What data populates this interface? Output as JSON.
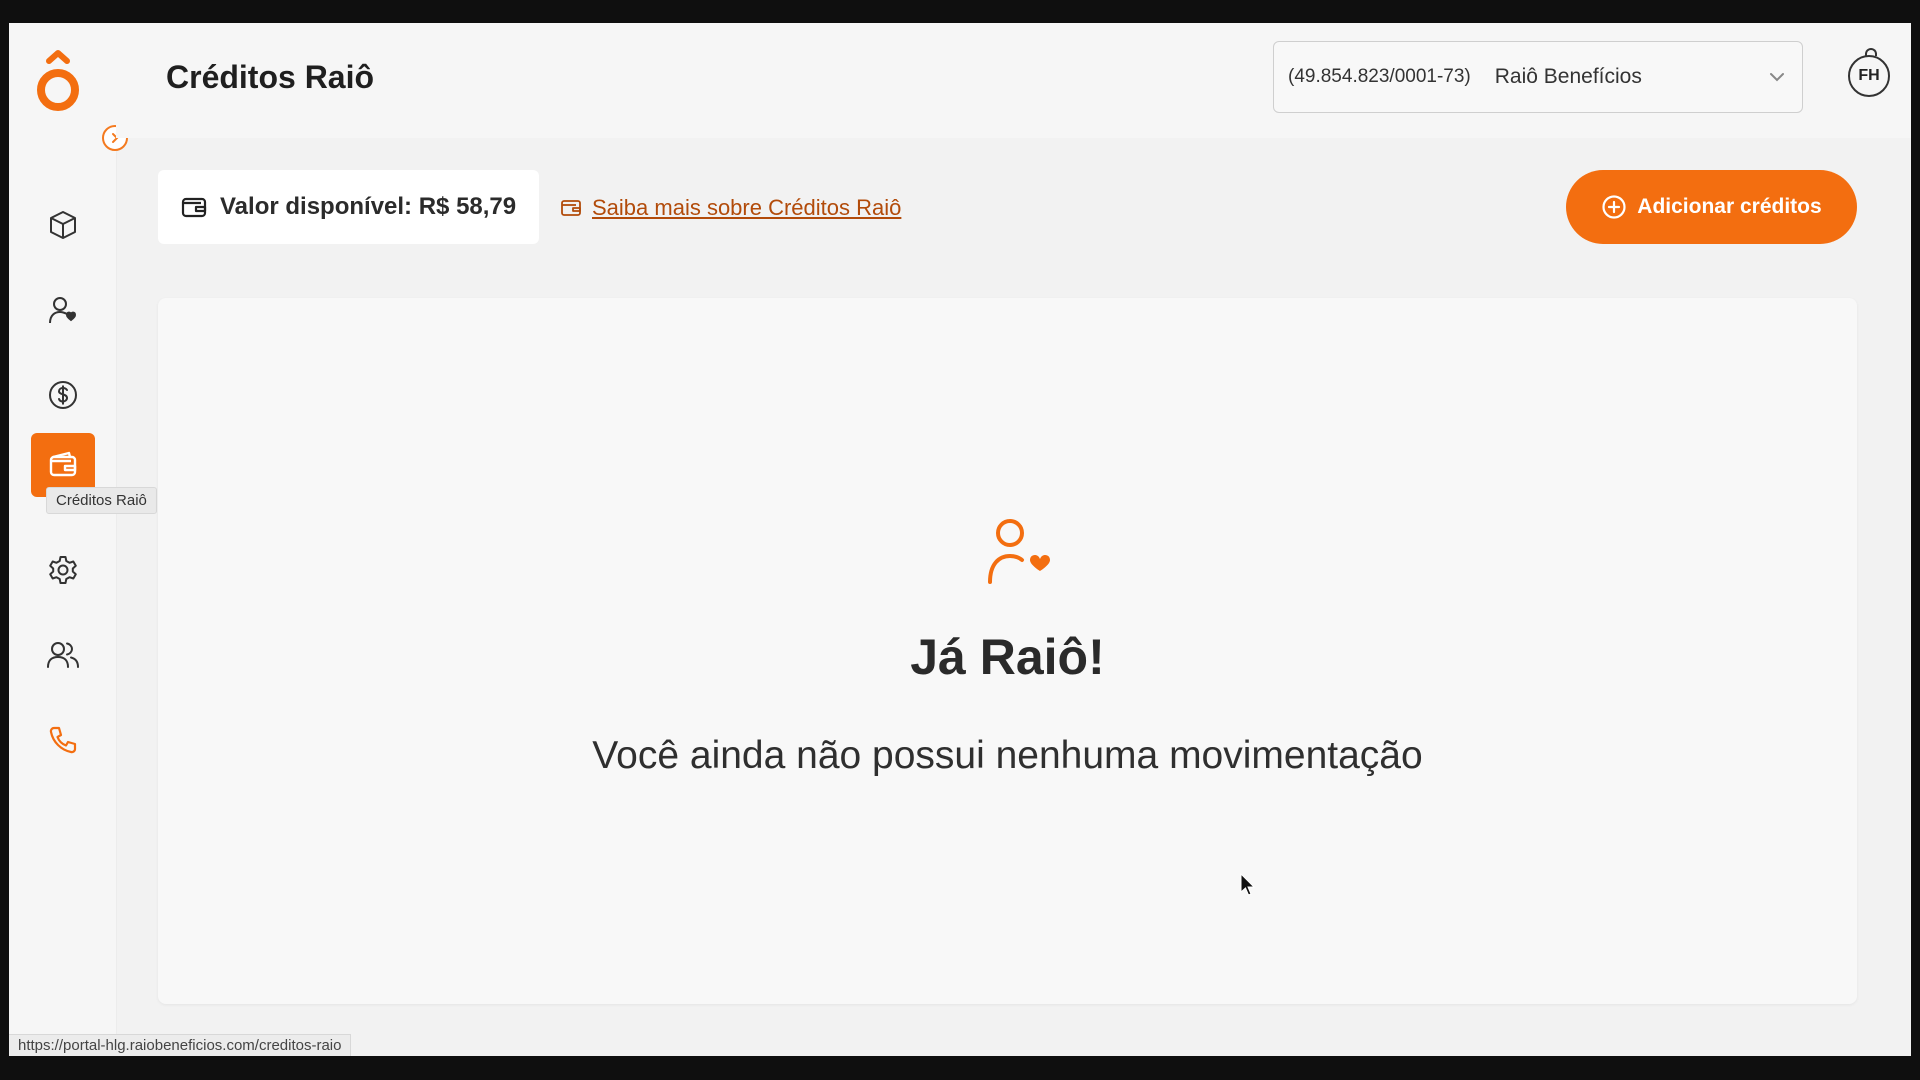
{
  "app": {
    "title": "Créditos Raiô"
  },
  "header": {
    "company_doc": "(49.854.823/0001-73)",
    "company_name": "Raiô Benefícios",
    "avatar_initials": "FH"
  },
  "sidebar": {
    "items": [
      {
        "icon": "box-icon",
        "label": ""
      },
      {
        "icon": "user-heart-icon",
        "label": ""
      },
      {
        "icon": "dollar-circle-icon",
        "label": ""
      },
      {
        "icon": "wallet-icon",
        "label": "Créditos Raiô",
        "active": true
      },
      {
        "icon": "gear-icon",
        "label": ""
      },
      {
        "icon": "users-icon",
        "label": ""
      },
      {
        "icon": "phone-icon",
        "label": ""
      }
    ],
    "tooltip": "Créditos Raiô"
  },
  "balance": {
    "label": "Valor disponível: R$ 58,79",
    "learn_more": "Saiba mais sobre Créditos Raiô"
  },
  "actions": {
    "add_credits": "Adicionar créditos"
  },
  "empty_state": {
    "title": "Já Raiô!",
    "subtitle": "Você ainda não possui nenhuma movimentação"
  },
  "status_bar": {
    "url": "https://portal-hlg.raiobeneficios.com/creditos-raio"
  },
  "colors": {
    "accent": "#f36e10",
    "link": "#b24b0a",
    "background": "#f2f2f2"
  }
}
